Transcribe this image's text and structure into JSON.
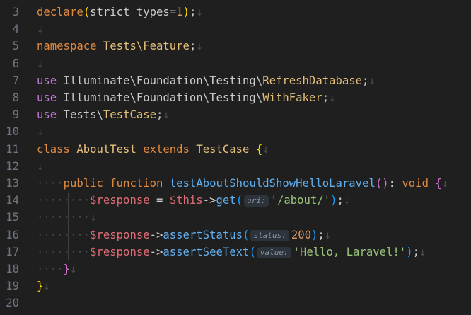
{
  "editor": {
    "lines": [
      {
        "n": "3",
        "tokens": [
          [
            "declare",
            "kw"
          ],
          [
            "(",
            "br1"
          ],
          [
            "strict_types",
            "ns"
          ],
          [
            "=",
            "op"
          ],
          [
            "1",
            "num"
          ],
          [
            ")",
            "br1"
          ],
          [
            ";",
            "punc"
          ],
          [
            "↓",
            "cm"
          ]
        ]
      },
      {
        "n": "4",
        "tokens": [
          [
            "↓",
            "cm"
          ]
        ]
      },
      {
        "n": "5",
        "tokens": [
          [
            "namespace",
            "kw"
          ],
          [
            " ",
            "ns"
          ],
          [
            "Tests\\Feature",
            "cls"
          ],
          [
            ";",
            "punc"
          ],
          [
            "↓",
            "cm"
          ]
        ]
      },
      {
        "n": "6",
        "tokens": [
          [
            "↓",
            "cm"
          ]
        ]
      },
      {
        "n": "7",
        "tokens": [
          [
            "use",
            "kw-use"
          ],
          [
            " Illuminate\\Foundation\\Testing\\",
            "ns"
          ],
          [
            "RefreshDatabase",
            "cls"
          ],
          [
            ";",
            "punc"
          ],
          [
            "↓",
            "cm"
          ]
        ]
      },
      {
        "n": "8",
        "tokens": [
          [
            "use",
            "kw-use"
          ],
          [
            " Illuminate\\Foundation\\Testing\\",
            "ns"
          ],
          [
            "WithFaker",
            "cls"
          ],
          [
            ";",
            "punc"
          ],
          [
            "↓",
            "cm"
          ]
        ]
      },
      {
        "n": "9",
        "tokens": [
          [
            "use",
            "kw-use"
          ],
          [
            " Tests\\",
            "ns"
          ],
          [
            "TestCase",
            "cls"
          ],
          [
            ";",
            "punc"
          ],
          [
            "↓",
            "cm"
          ]
        ]
      },
      {
        "n": "10",
        "tokens": [
          [
            "↓",
            "cm"
          ]
        ]
      },
      {
        "n": "11",
        "tokens": [
          [
            "class",
            "kw"
          ],
          [
            " ",
            "ns"
          ],
          [
            "AboutTest",
            "cls"
          ],
          [
            " ",
            "ns"
          ],
          [
            "extends",
            "kw"
          ],
          [
            " ",
            "ns"
          ],
          [
            "TestCase",
            "cls"
          ],
          [
            " ",
            "ns"
          ],
          [
            "{",
            "br1"
          ],
          [
            "↓",
            "cm"
          ]
        ]
      },
      {
        "n": "12",
        "tokens": [
          [
            "↓",
            "cm"
          ]
        ]
      },
      {
        "n": "13",
        "tokens": [
          [
            "····",
            "cm"
          ],
          [
            "public",
            "kw"
          ],
          [
            " ",
            "ns"
          ],
          [
            "function",
            "kw"
          ],
          [
            " ",
            "ns"
          ],
          [
            "testAboutShouldShowHelloLaravel",
            "fn"
          ],
          [
            "()",
            "br2"
          ],
          [
            ": ",
            "punc"
          ],
          [
            "void",
            "kw"
          ],
          [
            " ",
            "ns"
          ],
          [
            "{",
            "br2"
          ],
          [
            "↓",
            "cm"
          ]
        ]
      },
      {
        "n": "14",
        "tokens": [
          [
            "········",
            "cm"
          ],
          [
            "$response",
            "var"
          ],
          [
            " = ",
            "op"
          ],
          [
            "$this",
            "var"
          ],
          [
            "->",
            "op"
          ],
          [
            "get",
            "fn"
          ],
          [
            "(",
            "br3"
          ],
          [
            "@uri:",
            "hint"
          ],
          [
            "'/about/'",
            "str"
          ],
          [
            ")",
            "br3"
          ],
          [
            ";",
            "punc"
          ],
          [
            "↓",
            "cm"
          ]
        ]
      },
      {
        "n": "15",
        "tokens": [
          [
            "········",
            "cm"
          ],
          [
            "↓",
            "cm"
          ]
        ]
      },
      {
        "n": "16",
        "tokens": [
          [
            "········",
            "cm"
          ],
          [
            "$response",
            "var"
          ],
          [
            "->",
            "op"
          ],
          [
            "assertStatus",
            "fn"
          ],
          [
            "(",
            "br3"
          ],
          [
            "@status:",
            "hint"
          ],
          [
            "200",
            "num"
          ],
          [
            ")",
            "br3"
          ],
          [
            ";",
            "punc"
          ],
          [
            "↓",
            "cm"
          ]
        ]
      },
      {
        "n": "17",
        "tokens": [
          [
            "········",
            "cm"
          ],
          [
            "$response",
            "var"
          ],
          [
            "->",
            "op"
          ],
          [
            "assertSeeText",
            "fn"
          ],
          [
            "(",
            "br3"
          ],
          [
            "@value:",
            "hint"
          ],
          [
            "'Hello, Laravel!'",
            "str"
          ],
          [
            ")",
            "br3"
          ],
          [
            ";",
            "punc"
          ],
          [
            "↓",
            "cm"
          ]
        ]
      },
      {
        "n": "18",
        "tokens": [
          [
            "····",
            "cm"
          ],
          [
            "}",
            "br2"
          ],
          [
            "↓",
            "cm"
          ]
        ]
      },
      {
        "n": "19",
        "tokens": [
          [
            "}",
            "br1"
          ],
          [
            "↓",
            "cm"
          ]
        ]
      },
      {
        "n": "20",
        "tokens": []
      }
    ]
  }
}
